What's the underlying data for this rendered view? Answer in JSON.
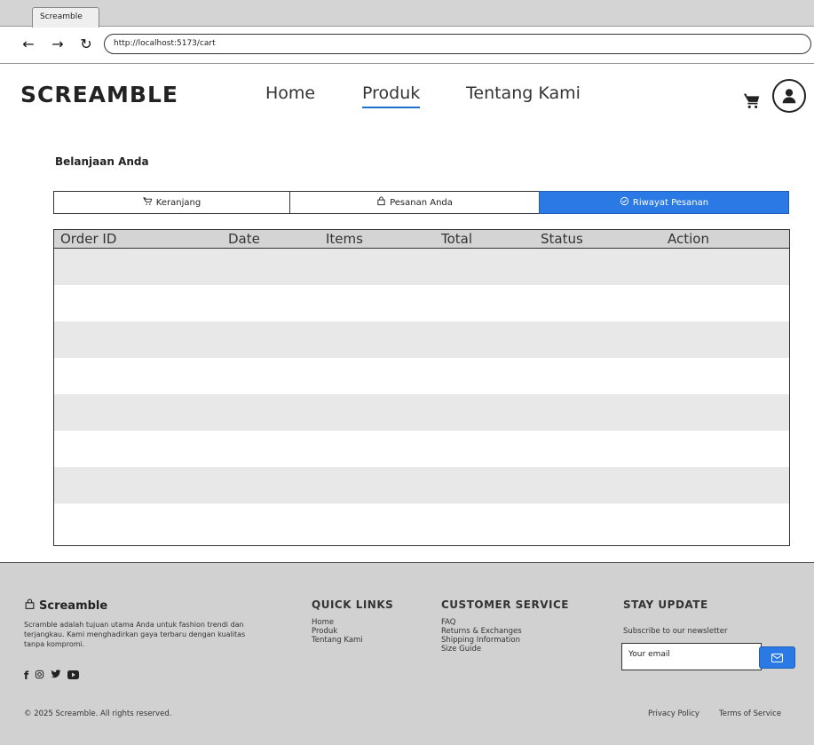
{
  "browser": {
    "tab_title": "Screamble",
    "url": "http://localhost:5173/cart"
  },
  "header": {
    "logo": "SCREAMBLE",
    "nav": [
      {
        "label": "Home"
      },
      {
        "label": "Produk",
        "active": true
      },
      {
        "label": "Tentang Kami"
      }
    ]
  },
  "main": {
    "title": "Belanjaan Anda",
    "tabs": [
      {
        "label": "Keranjang",
        "icon": "cart-icon"
      },
      {
        "label": "Pesanan Anda",
        "icon": "shopping-bag-icon"
      },
      {
        "label": "Riwayat Pesanan",
        "icon": "check-circle-icon",
        "active": true
      }
    ],
    "table": {
      "columns": [
        "Order ID",
        "Date",
        "Items",
        "Total",
        "Status",
        "Action"
      ],
      "rows": []
    }
  },
  "footer": {
    "brand": "Screamble",
    "description": "Scramble adalah tujuan utama Anda untuk fashion trendi dan terjangkau. Kami menghadirkan gaya terbaru dengan kualitas tanpa kompromi.",
    "social": [
      "facebook-icon",
      "instagram-icon",
      "twitter-icon",
      "youtube-icon"
    ],
    "quick_links": {
      "heading": "QUICK LINKS",
      "items": [
        "Home",
        "Produk",
        "Tentang Kami"
      ]
    },
    "customer_service": {
      "heading": "CUSTOMER SERVICE",
      "items": [
        "FAQ",
        "Returns & Exchanges",
        "Shipping Information",
        "Size Guide"
      ]
    },
    "stay_update": {
      "heading": "STAY UPDATE",
      "subtitle": "Subscribe to our newsletter",
      "email_placeholder": "Your email"
    },
    "copyright": "© 2025 Screamble. All rights reserved.",
    "privacy": "Privacy Policy",
    "terms": "Terms of Service"
  },
  "colors": {
    "accent": "#2a79e4",
    "footer_bg": "#d1d1d1",
    "table_header_bg": "#d4d4d4",
    "row_shade": "#e8e8e8"
  }
}
